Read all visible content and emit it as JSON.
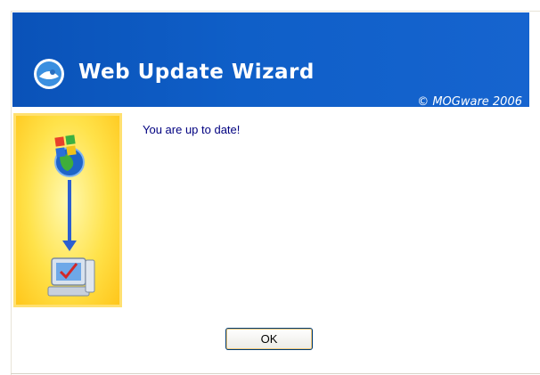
{
  "window": {
    "title": "Web Update Wizard",
    "copyright": "© MOGware 2006"
  },
  "main": {
    "message": "You are up to date!"
  },
  "buttons": {
    "ok_label": "OK"
  },
  "colors": {
    "banner_blue": "#0f5fc8",
    "message_text": "#000080",
    "side_art_yellow": "#ffe24a"
  },
  "icons": {
    "banner": "wizard-logo-icon",
    "side_top": "windows-globe-icon",
    "side_arrow": "arrow-down-icon",
    "side_bottom": "computer-check-icon"
  }
}
